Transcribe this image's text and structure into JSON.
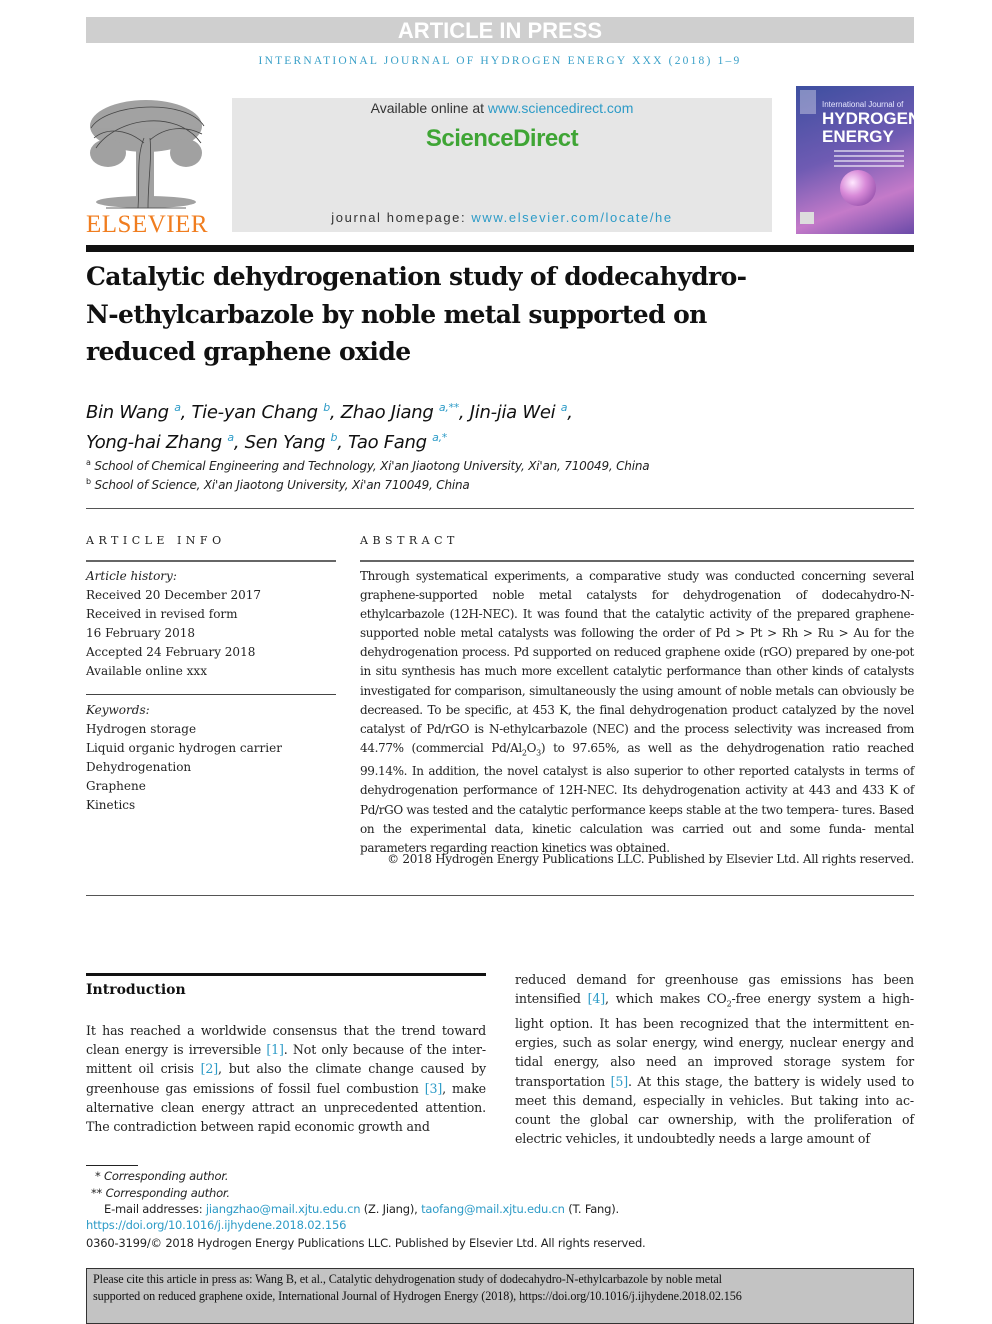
{
  "banner": {
    "label": "ARTICLE IN PRESS"
  },
  "journal_line": "INTERNATIONAL JOURNAL OF HYDROGEN ENERGY XXX (2018) 1–9",
  "header": {
    "publisher_logo_text": "ELSEVIER",
    "available_online_prefix": "Available online at ",
    "available_online_link": "www.sciencedirect.com",
    "brand": "ScienceDirect",
    "homepage_prefix": "journal homepage: ",
    "homepage_link": "www.elsevier.com/locate/he",
    "cover": {
      "subtitle": "International Journal of",
      "title_line1": "HYDROGEN",
      "title_line2": "ENERGY"
    }
  },
  "title": "Catalytic dehydrogenation study of dodecahydro-N-ethylcarbazole by noble metal supported on reduced graphene oxide",
  "title_lines": [
    "Catalytic dehydrogenation study of dodecahydro-",
    "N-ethylcarbazole by noble metal supported on",
    "reduced graphene oxide"
  ],
  "authors": [
    {
      "name": "Bin Wang",
      "sup": "a",
      "sep": ", "
    },
    {
      "name": "Tie-yan Chang",
      "sup": "b",
      "sep": ", "
    },
    {
      "name": "Zhao Jiang",
      "sup": "a,**",
      "sep": ", "
    },
    {
      "name": "Jin-jia Wei",
      "sup": "a",
      "sep": ","
    },
    {
      "name": "Yong-hai Zhang",
      "sup": "a",
      "sep": ", "
    },
    {
      "name": "Sen Yang",
      "sup": "b",
      "sep": ", "
    },
    {
      "name": "Tao Fang",
      "sup": "a,*",
      "sep": ""
    }
  ],
  "affiliations": [
    {
      "key": "a",
      "text": "School of Chemical Engineering and Technology, Xi'an Jiaotong University, Xi'an, 710049, China"
    },
    {
      "key": "b",
      "text": "School of Science, Xi'an Jiaotong University, Xi'an 710049, China"
    }
  ],
  "article_info": {
    "heading": "ARTICLE INFO",
    "history_label": "Article history:",
    "history": [
      "Received 20 December 2017",
      "Received in revised form",
      "16 February 2018",
      "Accepted 24 February 2018",
      "Available online xxx"
    ],
    "keywords_label": "Keywords:",
    "keywords": [
      "Hydrogen storage",
      "Liquid organic hydrogen carrier",
      "Dehydrogenation",
      "Graphene",
      "Kinetics"
    ]
  },
  "abstract": {
    "heading": "ABSTRACT",
    "part1": "Through systematical experiments, a comparative study was conducted concerning several graphene-supported noble metal catalysts for dehydrogenation of dodecahydro-N-ethylcarbazole (12H-NEC). It was found that the catalytic activity of the prepared graphene-supported noble metal catalysts was following the order of Pd > Pt > Rh > Ru > Au for the dehydrogenation process. Pd supported on reduced graphene oxide (rGO) prepared by one-pot in situ synthesis has much more excellent catalytic performance than other kinds of catalysts investigated for comparison, simultaneously the using amount of noble metals can obviously be decreased. To be specific, at 453 K, the final dehydrogenation product catalyzed by the novel catalyst of Pd/rGO is N-ethylcarbazole (NEC) and the process selectivity was increased from 44.77% (commercial Pd/Al",
    "sub1": "2",
    "mid": "O",
    "sub2": "3",
    "part2": ") to 97.65%, as well as the dehydrogenation ratio reached 99.14%. In addition, the novel catalyst is also superior to other reported catalysts in terms of dehydrogenation performance of 12H-NEC. Its dehydrogenation activity at 443 and 433 K of Pd/rGO was tested and the catalytic performance keeps stable at the two tempera- tures. Based on the experimental data, kinetic calculation was carried out and some funda- mental parameters regarding reaction kinetics was obtained.",
    "copyright": "© 2018 Hydrogen Energy Publications LLC. Published by Elsevier Ltd. All rights reserved."
  },
  "introduction": {
    "heading": "Introduction",
    "left": [
      {
        "t": "It has reached a worldwide consensus that the trend toward clean energy is irreversible "
      },
      {
        "ref": "[1]"
      },
      {
        "t": ". Not only because of the inter- mittent oil crisis "
      },
      {
        "ref": "[2]"
      },
      {
        "t": ", but also the climate change caused by greenhouse gas emissions of fossil fuel combustion "
      },
      {
        "ref": "[3]"
      },
      {
        "t": ", make alternative clean energy attract an unprecedented attention. The contradiction between rapid economic growth and"
      }
    ],
    "right": [
      {
        "t": "reduced demand for greenhouse gas emissions has been intensified "
      },
      {
        "ref": "[4]"
      },
      {
        "t": ", which makes CO"
      },
      {
        "sub": "2"
      },
      {
        "t": "-free energy system a high- light option. It has been recognized that the intermittent en- ergies, such as solar energy, wind energy, nuclear energy and tidal energy, also need an improved storage system for transportation "
      },
      {
        "ref": "[5]"
      },
      {
        "t": ". At this stage, the battery is widely used to meet this demand, especially in vehicles. But taking into ac- count the global car ownership, with the proliferation of electric vehicles, it undoubtedly needs a large amount of"
      }
    ]
  },
  "footnotes": {
    "corr1": "Corresponding author.",
    "corr1_mark": "*",
    "corr2": "Corresponding author.",
    "corr2_mark": "**",
    "email_label": "E-mail addresses: ",
    "email1": "jiangzhao@mail.xjtu.edu.cn",
    "email1_who": " (Z. Jiang), ",
    "email2": "taofang@mail.xjtu.edu.cn",
    "email2_who": " (T. Fang).",
    "doi": "https://doi.org/10.1016/j.ijhydene.2018.02.156",
    "issn": "0360-3199/© 2018 Hydrogen Energy Publications LLC. Published by Elsevier Ltd. All rights reserved."
  },
  "citation_box": {
    "line1": "Please cite this article in press as: Wang B, et al., Catalytic dehydrogenation study of dodecahydro-N-ethylcarbazole by noble metal",
    "line2": "supported on reduced graphene oxide, International Journal of Hydrogen Energy (2018), https://doi.org/10.1016/j.ijhydene.2018.02.156"
  },
  "colors": {
    "link": "#2d9bc7",
    "brand_green": "#3fa535",
    "elsevier_orange": "#f07d1f",
    "banner_gray": "#cfcfcf"
  }
}
